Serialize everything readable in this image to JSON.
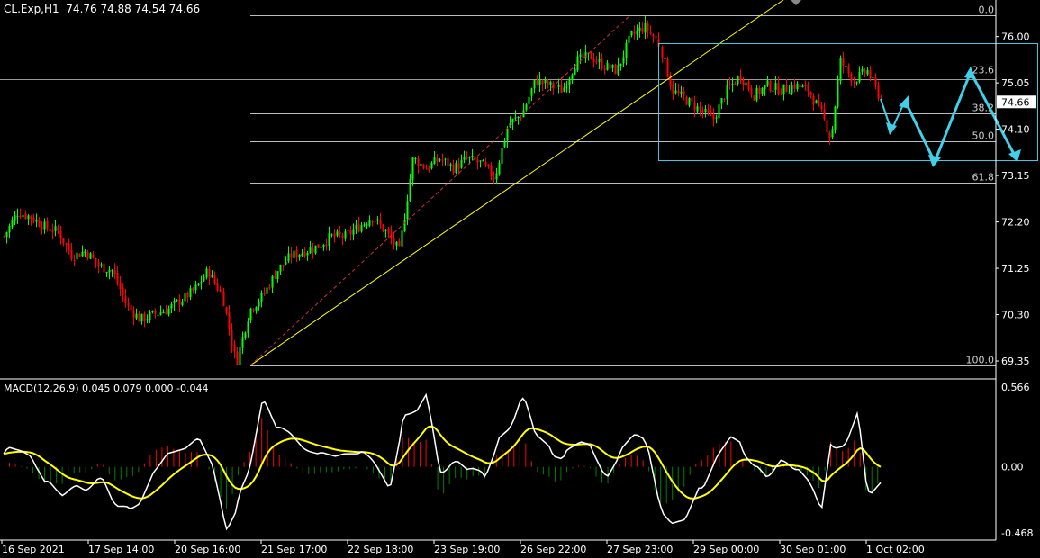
{
  "header": {
    "symbol": "CL.Exp,H1",
    "ohlc": "74.76 74.88 74.54 74.66"
  },
  "current_price": "74.66",
  "colors": {
    "background": "#000000",
    "bull_candle": "#00ff00",
    "bear_candle": "#ff0000",
    "trendline": "#ffff00",
    "box": "#3fc8e0",
    "arrows": "#3fd0ea",
    "macd_line": "#ffffff",
    "signal_line": "#ffff00",
    "hist_pos": "#ff0000",
    "hist_neg": "#008000"
  },
  "price_axis": {
    "ticks": [
      "76.00",
      "75.05",
      "74.10",
      "73.15",
      "72.20",
      "71.25",
      "70.30",
      "69.35"
    ]
  },
  "fib_levels": [
    {
      "label": "0.0",
      "price": 76.44
    },
    {
      "label": "23.6",
      "price": 75.2
    },
    {
      "label": "38.2",
      "price": 74.43
    },
    {
      "label": "50.0",
      "price": 73.85
    },
    {
      "label": "61.8",
      "price": 73.0
    },
    {
      "label": "100.0",
      "price": 69.26
    }
  ],
  "macd": {
    "label": "MACD(12,26,9) 0.045 0.079 0.000 -0.044",
    "ticks": [
      "0.566",
      "0.00",
      "-0.468"
    ]
  },
  "time_axis": {
    "labels": [
      "16 Sep 2021",
      "17 Sep 14:00",
      "20 Sep 16:00",
      "21 Sep 17:00",
      "22 Sep 18:00",
      "23 Sep 19:00",
      "26 Sep 22:00",
      "27 Sep 23:00",
      "29 Sep 00:00",
      "30 Sep 01:00",
      "1 Oct 02:00"
    ]
  },
  "chart_data": {
    "type": "candlestick",
    "symbol": "CL.Exp",
    "timeframe": "H1",
    "ylim": [
      69.0,
      76.75
    ],
    "close_path": [
      {
        "t": 0,
        "c": 71.9
      },
      {
        "t": 3,
        "c": 72.4
      },
      {
        "t": 6,
        "c": 72.3
      },
      {
        "t": 9,
        "c": 72.1
      },
      {
        "t": 12,
        "c": 72.0
      },
      {
        "t": 15,
        "c": 71.5
      },
      {
        "t": 18,
        "c": 71.6
      },
      {
        "t": 21,
        "c": 71.3
      },
      {
        "t": 24,
        "c": 71.2
      },
      {
        "t": 27,
        "c": 70.5
      },
      {
        "t": 30,
        "c": 70.2
      },
      {
        "t": 33,
        "c": 70.3
      },
      {
        "t": 36,
        "c": 70.4
      },
      {
        "t": 39,
        "c": 70.6
      },
      {
        "t": 42,
        "c": 70.8
      },
      {
        "t": 45,
        "c": 71.2
      },
      {
        "t": 48,
        "c": 70.7
      },
      {
        "t": 51,
        "c": 69.3
      },
      {
        "t": 54,
        "c": 70.4
      },
      {
        "t": 57,
        "c": 70.7
      },
      {
        "t": 60,
        "c": 71.2
      },
      {
        "t": 63,
        "c": 71.5
      },
      {
        "t": 66,
        "c": 71.6
      },
      {
        "t": 69,
        "c": 71.7
      },
      {
        "t": 72,
        "c": 71.9
      },
      {
        "t": 75,
        "c": 71.9
      },
      {
        "t": 78,
        "c": 72.1
      },
      {
        "t": 81,
        "c": 72.3
      },
      {
        "t": 84,
        "c": 72.0
      },
      {
        "t": 87,
        "c": 71.6
      },
      {
        "t": 90,
        "c": 73.5
      },
      {
        "t": 93,
        "c": 73.3
      },
      {
        "t": 96,
        "c": 73.5
      },
      {
        "t": 99,
        "c": 73.3
      },
      {
        "t": 102,
        "c": 73.5
      },
      {
        "t": 105,
        "c": 73.4
      },
      {
        "t": 108,
        "c": 73.1
      },
      {
        "t": 111,
        "c": 74.2
      },
      {
        "t": 114,
        "c": 74.4
      },
      {
        "t": 117,
        "c": 75.1
      },
      {
        "t": 120,
        "c": 75.0
      },
      {
        "t": 123,
        "c": 74.9
      },
      {
        "t": 126,
        "c": 75.5
      },
      {
        "t": 129,
        "c": 75.6
      },
      {
        "t": 132,
        "c": 75.4
      },
      {
        "t": 135,
        "c": 75.3
      },
      {
        "t": 138,
        "c": 76.0
      },
      {
        "t": 141,
        "c": 76.2
      },
      {
        "t": 144,
        "c": 75.9
      },
      {
        "t": 147,
        "c": 74.9
      },
      {
        "t": 150,
        "c": 74.7
      },
      {
        "t": 153,
        "c": 74.5
      },
      {
        "t": 156,
        "c": 74.3
      },
      {
        "t": 159,
        "c": 74.9
      },
      {
        "t": 162,
        "c": 75.2
      },
      {
        "t": 165,
        "c": 74.8
      },
      {
        "t": 168,
        "c": 75.0
      },
      {
        "t": 171,
        "c": 74.9
      },
      {
        "t": 174,
        "c": 75.0
      },
      {
        "t": 177,
        "c": 74.9
      },
      {
        "t": 180,
        "c": 74.4
      },
      {
        "t": 182,
        "c": 73.9
      },
      {
        "t": 184,
        "c": 75.5
      },
      {
        "t": 187,
        "c": 75.1
      },
      {
        "t": 190,
        "c": 75.3
      },
      {
        "t": 193,
        "c": 74.7
      }
    ]
  }
}
